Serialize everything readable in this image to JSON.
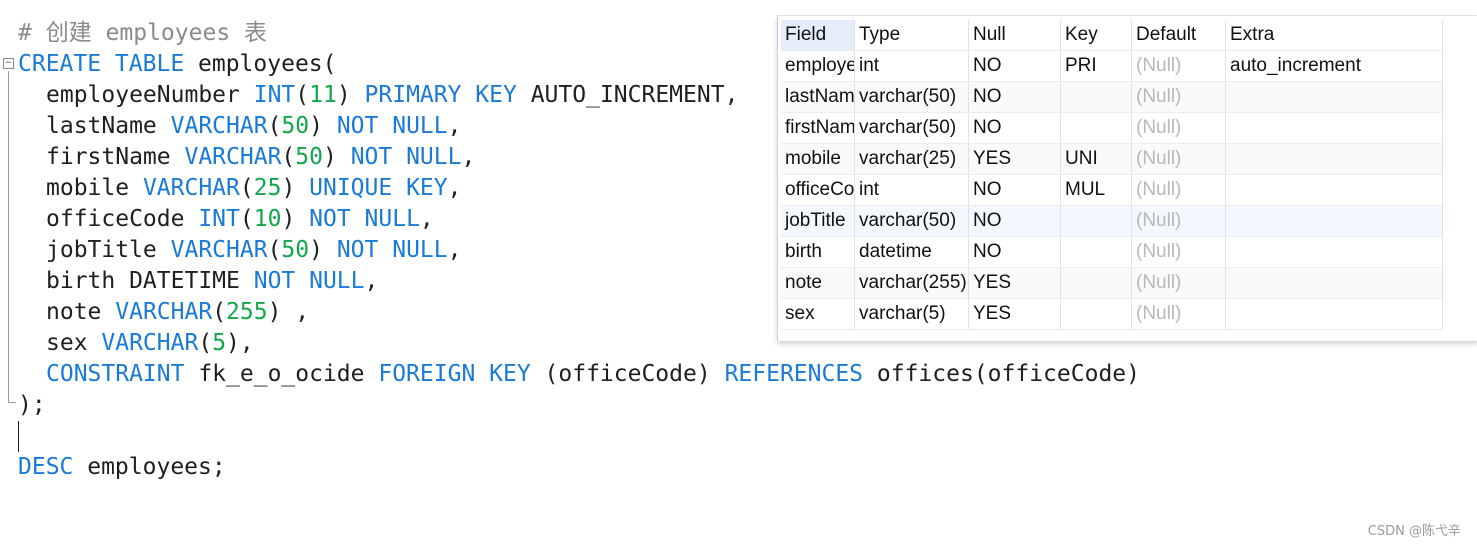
{
  "editor": {
    "comment": "# 创建 employees 表",
    "create_kw": "CREATE TABLE",
    "table_name": " employees(",
    "lines": {
      "l1": {
        "col": "employeeNumber ",
        "type": "INT",
        "p1": "(",
        "n": "11",
        "p2": ") ",
        "c": "PRIMARY KEY",
        "tail": " AUTO_INCREMENT,"
      },
      "l2": {
        "col": "lastName ",
        "type": "VARCHAR",
        "p1": "(",
        "n": "50",
        "p2": ") ",
        "c": "NOT NULL",
        "tail": ","
      },
      "l3": {
        "col": "firstName ",
        "type": "VARCHAR",
        "p1": "(",
        "n": "50",
        "p2": ") ",
        "c": "NOT NULL",
        "tail": ","
      },
      "l4": {
        "col": "mobile ",
        "type": "VARCHAR",
        "p1": "(",
        "n": "25",
        "p2": ") ",
        "c": "UNIQUE KEY",
        "tail": ","
      },
      "l5": {
        "col": "officeCode ",
        "type": "INT",
        "p1": "(",
        "n": "10",
        "p2": ") ",
        "c": "NOT NULL",
        "tail": ","
      },
      "l6": {
        "col": "jobTitle ",
        "type": "VARCHAR",
        "p1": "(",
        "n": "50",
        "p2": ") ",
        "c": "NOT NULL",
        "tail": ","
      },
      "l7": {
        "col": "birth DATETIME ",
        "c": "NOT NULL",
        "tail": ","
      },
      "l8": {
        "col": "note ",
        "type": "VARCHAR",
        "p1": "(",
        "n": "255",
        "p2": ") ",
        "tail": ","
      },
      "l9": {
        "col": "sex ",
        "type": "VARCHAR",
        "p1": "(",
        "n": "5",
        "p2": ")",
        "tail": ","
      },
      "l10": {
        "k1": "CONSTRAINT",
        "name": " fk_e_o_ocide ",
        "k2": "FOREIGN KEY",
        "mid": " (officeCode) ",
        "k3": "REFERENCES",
        "tail": " offices(officeCode)"
      }
    },
    "close": ");",
    "desc_kw": "DESC",
    "desc_rest": " employees;"
  },
  "result": {
    "headers": [
      "Field",
      "Type",
      "Null",
      "Key",
      "Default",
      "Extra"
    ],
    "rows": [
      [
        "employeeNumber",
        "int",
        "NO",
        "PRI",
        "(Null)",
        "auto_increment"
      ],
      [
        "lastName",
        "varchar(50)",
        "NO",
        "",
        "(Null)",
        ""
      ],
      [
        "firstName",
        "varchar(50)",
        "NO",
        "",
        "(Null)",
        ""
      ],
      [
        "mobile",
        "varchar(25)",
        "YES",
        "UNI",
        "(Null)",
        ""
      ],
      [
        "officeCode",
        "int",
        "NO",
        "MUL",
        "(Null)",
        ""
      ],
      [
        "jobTitle",
        "varchar(50)",
        "NO",
        "",
        "(Null)",
        ""
      ],
      [
        "birth",
        "datetime",
        "NO",
        "",
        "(Null)",
        ""
      ],
      [
        "note",
        "varchar(255)",
        "YES",
        "",
        "(Null)",
        ""
      ],
      [
        "sex",
        "varchar(5)",
        "YES",
        "",
        "(Null)",
        ""
      ]
    ]
  },
  "watermark": "CSDN @陈弋辛",
  "colors": {
    "keyword": "#1a7ad8",
    "number": "#11a84c",
    "comment": "#8a8a8a",
    "null": "#b8b8b8"
  }
}
